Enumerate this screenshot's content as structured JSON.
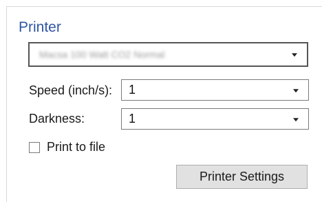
{
  "printer_section": {
    "title": "Printer",
    "printer_select": {
      "value": "Macsa 100 Watt CO2 Normal"
    },
    "speed": {
      "label": "Speed (inch/s):",
      "value": "1"
    },
    "darkness": {
      "label": "Darkness:",
      "value": "1"
    },
    "print_to_file": {
      "label": "Print to file",
      "checked": false
    },
    "settings_button": {
      "label": "Printer Settings"
    }
  }
}
